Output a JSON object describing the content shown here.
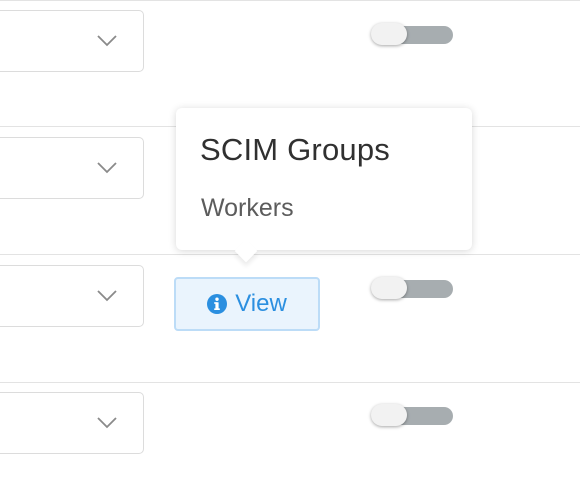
{
  "popover": {
    "title": "SCIM Groups",
    "body": "Workers"
  },
  "view_button": {
    "label": "View",
    "icon": "info-circle-icon"
  },
  "rows": [
    {
      "select_icon": "chevron-down-icon",
      "toggle_on": false
    },
    {
      "select_icon": "chevron-down-icon"
    },
    {
      "select_icon": "chevron-down-icon",
      "toggle_on": false
    },
    {
      "select_icon": "chevron-down-icon",
      "toggle_on": false
    }
  ],
  "colors": {
    "accent": "#2b8fe0",
    "button_background": "#eaf4fd",
    "toggle_track": "#a7adb0",
    "divider": "#e3e3e3"
  }
}
